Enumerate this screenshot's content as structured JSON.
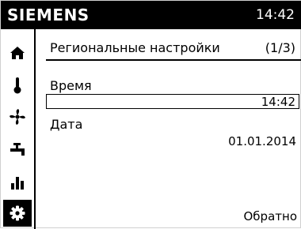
{
  "header": {
    "brand": "SIEMENS",
    "clock": "14:42",
    "background": "#000000",
    "text_color": "#ffffff"
  },
  "sidebar": {
    "items": [
      {
        "icon": "home-icon",
        "active": false
      },
      {
        "icon": "thermometer-icon",
        "active": false
      },
      {
        "icon": "fan-icon",
        "active": false
      },
      {
        "icon": "faucet-icon",
        "active": false
      },
      {
        "icon": "bar-chart-icon",
        "active": false
      },
      {
        "icon": "gear-icon",
        "active": true
      }
    ]
  },
  "main": {
    "title": "Региональные настройки",
    "page_indicator": "(1/3)",
    "time_label": "Время",
    "time_value": "14:42",
    "date_label": "Дата",
    "date_value": "01.01.2014",
    "back_label": "Обратно"
  }
}
